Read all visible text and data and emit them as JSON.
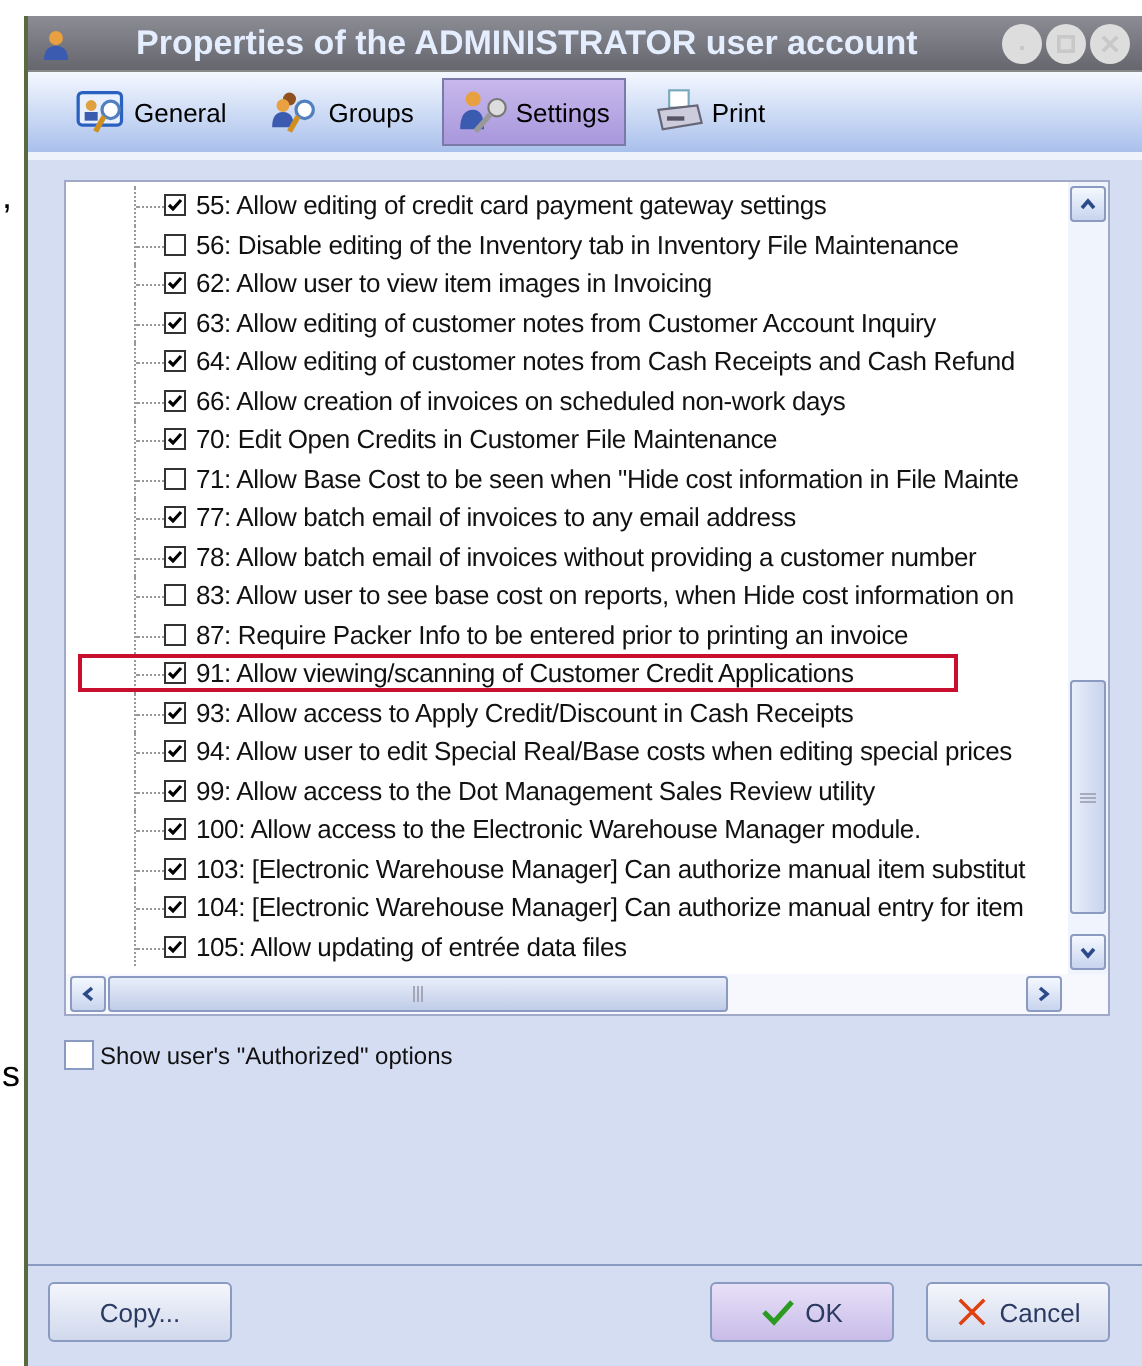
{
  "background_text": [
    ",",
    "s"
  ],
  "window": {
    "title": "Properties of the ADMINISTRATOR user account"
  },
  "tabs": [
    {
      "label": "General",
      "selected": false,
      "kind": "general"
    },
    {
      "label": "Groups",
      "selected": false,
      "kind": "groups"
    },
    {
      "label": "Settings",
      "selected": true,
      "kind": "settings"
    },
    {
      "label": "Print",
      "selected": false,
      "kind": "print"
    }
  ],
  "options": [
    {
      "label": "55: Allow editing of credit card payment gateway settings",
      "checked": true,
      "highlighted": false
    },
    {
      "label": "56: Disable editing of the Inventory tab in Inventory File Maintenance",
      "checked": false,
      "highlighted": false
    },
    {
      "label": "62: Allow user to view item images in Invoicing",
      "checked": true,
      "highlighted": false
    },
    {
      "label": "63: Allow editing of customer notes from Customer Account Inquiry",
      "checked": true,
      "highlighted": false
    },
    {
      "label": "64: Allow editing of customer notes from Cash Receipts and Cash Refund",
      "checked": true,
      "highlighted": false
    },
    {
      "label": "66: Allow creation of invoices on scheduled non-work days",
      "checked": true,
      "highlighted": false
    },
    {
      "label": "70: Edit Open Credits in Customer File Maintenance",
      "checked": true,
      "highlighted": false
    },
    {
      "label": "71: Allow Base Cost to be seen when \"Hide cost information in File Mainte",
      "checked": false,
      "highlighted": false
    },
    {
      "label": "77: Allow batch email of invoices to any email address",
      "checked": true,
      "highlighted": false
    },
    {
      "label": "78: Allow batch email of invoices without providing a customer number",
      "checked": true,
      "highlighted": false
    },
    {
      "label": "83: Allow user to see base cost on reports, when Hide cost information on",
      "checked": false,
      "highlighted": false
    },
    {
      "label": "87: Require Packer Info to be entered prior to printing an invoice",
      "checked": false,
      "highlighted": false
    },
    {
      "label": "91: Allow viewing/scanning of Customer Credit Applications",
      "checked": true,
      "highlighted": true
    },
    {
      "label": "93: Allow access to Apply Credit/Discount in Cash Receipts",
      "checked": true,
      "highlighted": false
    },
    {
      "label": "94: Allow user to edit Special Real/Base costs when editing special prices",
      "checked": true,
      "highlighted": false
    },
    {
      "label": "99: Allow access to the Dot Management Sales Review utility",
      "checked": true,
      "highlighted": false
    },
    {
      "label": "100: Allow access to the Electronic Warehouse Manager module.",
      "checked": true,
      "highlighted": false
    },
    {
      "label": "103: [Electronic Warehouse Manager] Can authorize manual item substitut",
      "checked": true,
      "highlighted": false
    },
    {
      "label": "104: [Electronic Warehouse Manager] Can authorize manual entry for item",
      "checked": true,
      "highlighted": false
    },
    {
      "label": "105: Allow updating of entrée data files",
      "checked": true,
      "highlighted": false
    }
  ],
  "show_authorized": {
    "label": "Show user's \"Authorized\" options",
    "checked": false
  },
  "buttons": [
    {
      "label": "Copy...",
      "kind": "copy"
    },
    {
      "label": "OK",
      "kind": "ok"
    },
    {
      "label": "Cancel",
      "kind": "cancel"
    }
  ]
}
